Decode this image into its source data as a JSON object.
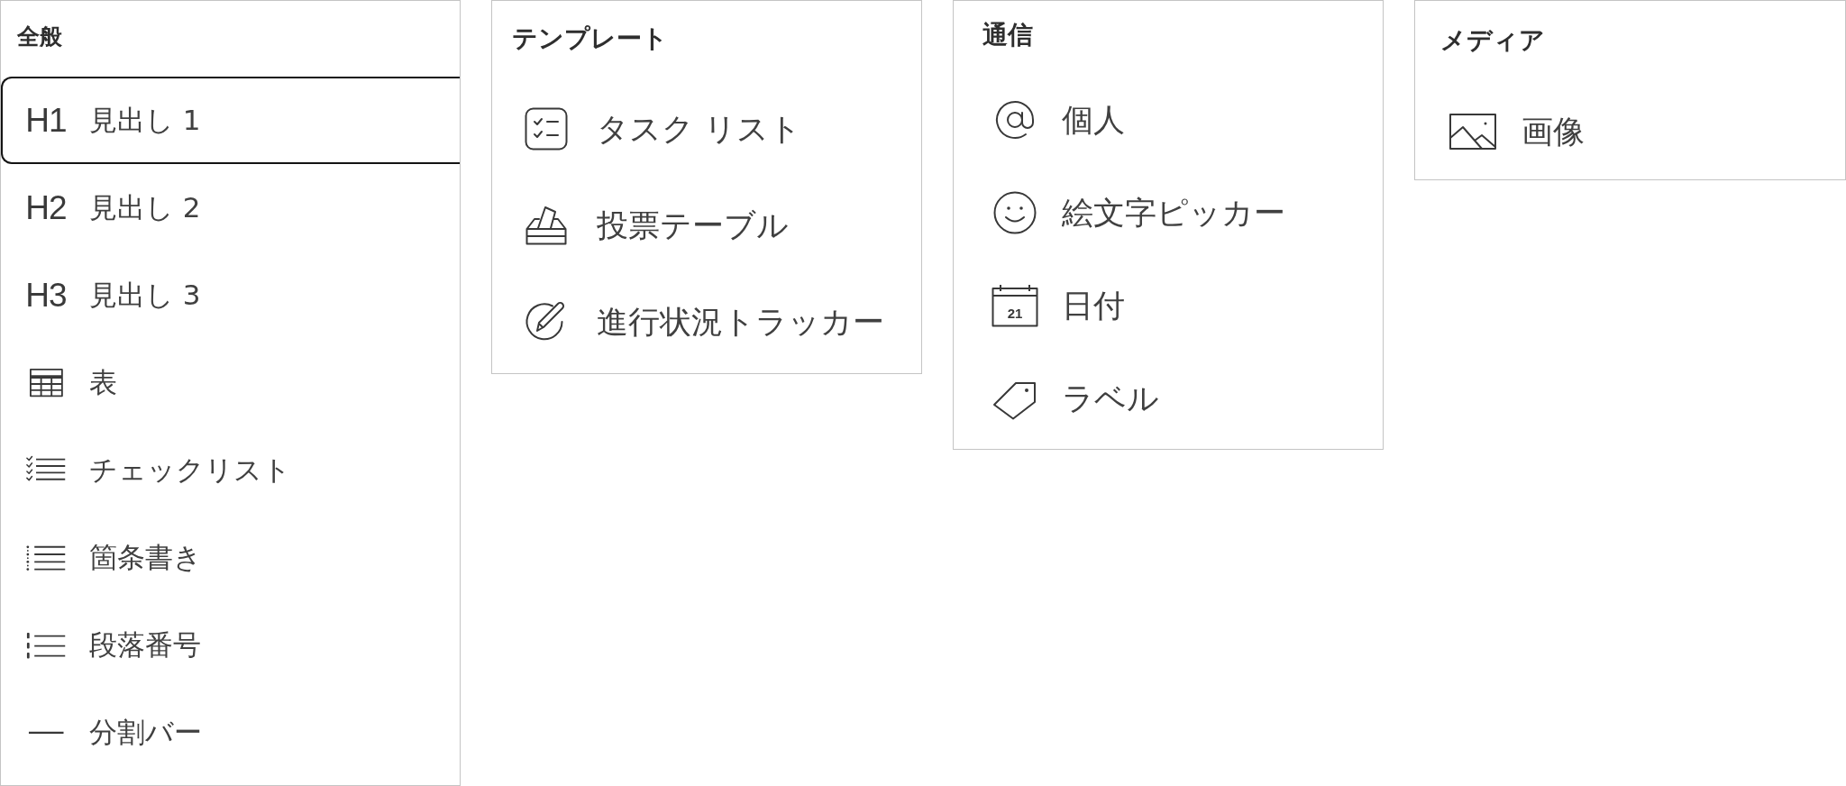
{
  "panels": [
    {
      "title": "全般",
      "items": [
        {
          "kind": "heading",
          "icon_text": "H1",
          "label": "見出し 1",
          "selected": true
        },
        {
          "kind": "heading",
          "icon_text": "H2",
          "label": "見出し 2",
          "selected": false
        },
        {
          "kind": "heading",
          "icon_text": "H3",
          "label": "見出し 3",
          "selected": false
        },
        {
          "kind": "table",
          "label": "表",
          "selected": false
        },
        {
          "kind": "checklist",
          "label": "チェックリスト",
          "selected": false
        },
        {
          "kind": "bullets",
          "label": "箇条書き",
          "selected": false
        },
        {
          "kind": "numbered",
          "label": "段落番号",
          "selected": false
        },
        {
          "kind": "divider",
          "label": "分割バー",
          "selected": false
        }
      ]
    },
    {
      "title": "テンプレート",
      "items": [
        {
          "kind": "task-list",
          "label": "タスク リスト",
          "selected": false
        },
        {
          "kind": "ballot",
          "label": "投票テーブル",
          "selected": false
        },
        {
          "kind": "progress",
          "label": "進行状況トラッカー",
          "selected": false
        }
      ]
    },
    {
      "title": "通信",
      "items": [
        {
          "kind": "mention",
          "label": "個人",
          "selected": false
        },
        {
          "kind": "emoji",
          "label": "絵文字ピッカー",
          "selected": false
        },
        {
          "kind": "date",
          "icon_text": "21",
          "label": "日付",
          "selected": false
        },
        {
          "kind": "tag",
          "label": "ラベル",
          "selected": false
        }
      ]
    },
    {
      "title": "メディア",
      "items": [
        {
          "kind": "image",
          "label": "画像",
          "selected": false
        }
      ]
    }
  ]
}
